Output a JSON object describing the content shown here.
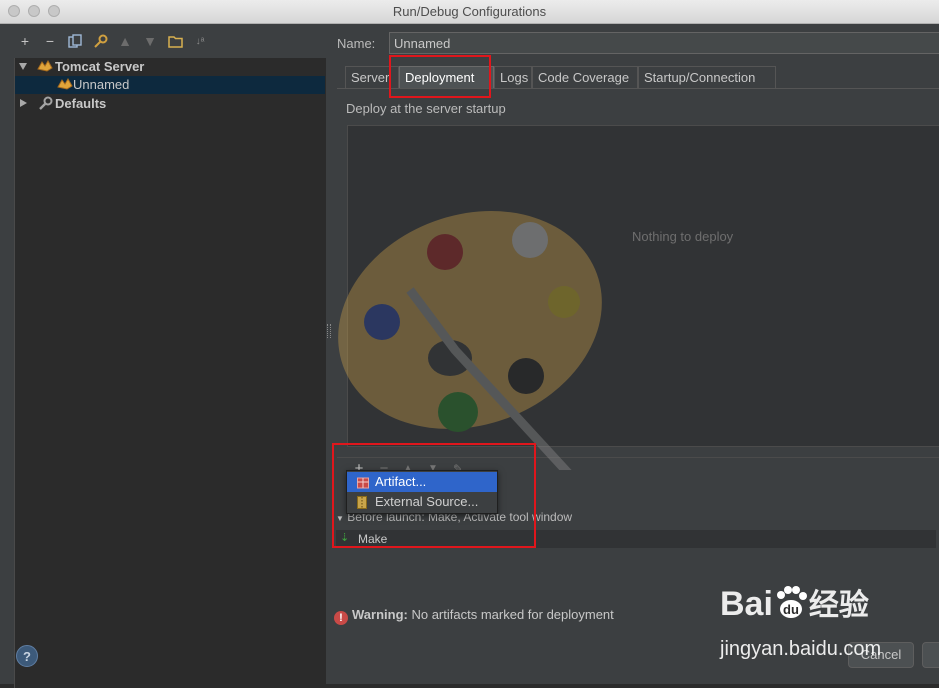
{
  "window": {
    "title": "Run/Debug Configurations"
  },
  "tree": {
    "items": [
      {
        "label": "Tomcat Server"
      },
      {
        "label": "Unnamed"
      },
      {
        "label": "Defaults"
      }
    ]
  },
  "config": {
    "name_label": "Name:",
    "name_value": "Unnamed"
  },
  "tabs": [
    "Server",
    "Deployment",
    "Logs",
    "Code Coverage",
    "Startup/Connection"
  ],
  "deployment": {
    "section_label": "Deploy at the server startup",
    "empty_text": "Nothing to deploy"
  },
  "add_menu": {
    "items": [
      "Artifact...",
      "External Source..."
    ]
  },
  "before_launch": {
    "label": "Before launch: Make, Activate tool window",
    "tasks": [
      "Make"
    ]
  },
  "warning": {
    "prefix": "Warning:",
    "message": "No artifacts marked for deployment"
  },
  "buttons": {
    "cancel": "Cancel",
    "help": "?"
  },
  "watermark": {
    "brand": "Bai",
    "brand2": "du",
    "cn": "经验",
    "url": "jingyan.baidu.com"
  },
  "colors": {
    "accent": "#2f65ca",
    "highlight_box": "#e0161c",
    "warning": "#c94a47",
    "selection": "#0d293e"
  }
}
